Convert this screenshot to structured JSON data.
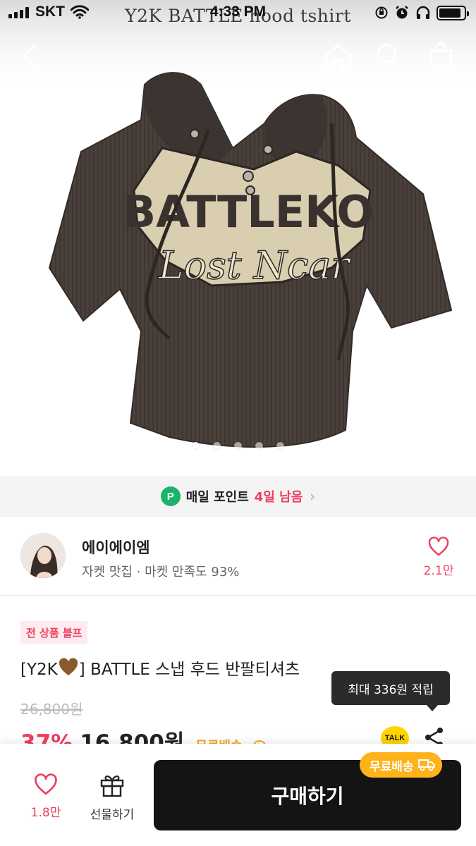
{
  "status_bar": {
    "carrier": "SKT",
    "time": "4:33 PM"
  },
  "hero": {
    "caption": "Y2K BATTLE hood tshirt",
    "graphic_title": "BATTLEKO",
    "graphic_script": "Lost Ncar",
    "slide_count": 5,
    "active_slide": 1
  },
  "nav": {
    "back_icon": "chevron-left-icon",
    "home_icon": "home-icon",
    "search_icon": "search-icon",
    "cart_icon": "shopping-bag-icon"
  },
  "point_banner": {
    "badge": "P",
    "label": "매일 포인트",
    "days_left": "4일 남음"
  },
  "shop": {
    "name": "에이에이엠",
    "description": "자켓 맛집 · 마켓 만족도 93%",
    "like_count": "2.1만"
  },
  "product": {
    "promo_tag": "전 상품 블프",
    "title_prefix": "[Y2K",
    "title_suffix": "] BATTLE 스냅 후드 반팔티셔츠",
    "original_price": "26,800원",
    "discount": "37%",
    "sale_price": "16,800원",
    "shipping": "무료배송"
  },
  "tooltip": {
    "text": "최대 336원 적립"
  },
  "talk": {
    "label": "TALK"
  },
  "bottom_bar": {
    "like_count": "1.8만",
    "gift_label": "선물하기",
    "buy_label": "구매하기",
    "ship_badge": "무료배송"
  },
  "colors": {
    "accent": "#ef3e5d",
    "point_green": "#1bb36b",
    "shipping_orange": "#ffb21a",
    "buy_button": "#141414",
    "shirt": "#4a403b"
  }
}
